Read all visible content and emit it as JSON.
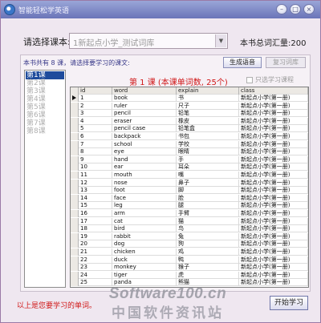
{
  "window": {
    "title": "智能轻松学英语",
    "minimize_glyph": "–",
    "maximize_glyph": "□",
    "close_glyph": "×",
    "title_gradient": [
      "#9aa6d8",
      "#6a74b8"
    ]
  },
  "course": {
    "label": "请选择课本:",
    "selected": "1新起点小学_测试词库",
    "arrow": "▼",
    "vocab_total": "本书总词汇量:200"
  },
  "toolbar": {
    "lesson_count_text": "本书共有 8 课，请选择要学习的课文:",
    "generate_audio_label": "生成语音",
    "review_label": "复习词库"
  },
  "lessons": [
    "第1课",
    "第2课",
    "第3课",
    "第4课",
    "第5课",
    "第6课",
    "第7课",
    "第8课"
  ],
  "selected_lesson_index": 0,
  "lesson_header": {
    "title": "第 1 课 (本课单词数, 25个)",
    "checkbox_label": "只选学习课程"
  },
  "table": {
    "columns": [
      "id",
      "word",
      "explain",
      "class"
    ],
    "rows": [
      [
        "1",
        "book",
        "书",
        "新起点小学(第一册)"
      ],
      [
        "2",
        "ruler",
        "尺子",
        "新起点小学(第一册)"
      ],
      [
        "3",
        "pencil",
        "铅笔",
        "新起点小学(第一册)"
      ],
      [
        "4",
        "eraser",
        "橡皮",
        "新起点小学(第一册)"
      ],
      [
        "5",
        "pencil case",
        "铅笔盒",
        "新起点小学(第一册)"
      ],
      [
        "6",
        "backpack",
        "书包",
        "新起点小学(第一册)"
      ],
      [
        "7",
        "school",
        "学校",
        "新起点小学(第一册)"
      ],
      [
        "8",
        "eye",
        "眼睛",
        "新起点小学(第一册)"
      ],
      [
        "9",
        "hand",
        "手",
        "新起点小学(第一册)"
      ],
      [
        "10",
        "ear",
        "耳朵",
        "新起点小学(第一册)"
      ],
      [
        "11",
        "mouth",
        "嘴",
        "新起点小学(第一册)"
      ],
      [
        "12",
        "nose",
        "鼻子",
        "新起点小学(第一册)"
      ],
      [
        "13",
        "foot",
        "脚",
        "新起点小学(第一册)"
      ],
      [
        "14",
        "face",
        "脸",
        "新起点小学(第一册)"
      ],
      [
        "15",
        "leg",
        "腿",
        "新起点小学(第一册)"
      ],
      [
        "16",
        "arm",
        "手臂",
        "新起点小学(第一册)"
      ],
      [
        "17",
        "cat",
        "猫",
        "新起点小学(第一册)"
      ],
      [
        "18",
        "bird",
        "鸟",
        "新起点小学(第一册)"
      ],
      [
        "19",
        "rabbit",
        "兔",
        "新起点小学(第一册)"
      ],
      [
        "20",
        "dog",
        "狗",
        "新起点小学(第一册)"
      ],
      [
        "21",
        "chicken",
        "鸡",
        "新起点小学(第一册)"
      ],
      [
        "22",
        "duck",
        "鸭",
        "新起点小学(第一册)"
      ],
      [
        "23",
        "monkey",
        "猴子",
        "新起点小学(第一册)"
      ],
      [
        "24",
        "tiger",
        "虎",
        "新起点小学(第一册)"
      ],
      [
        "25",
        "panda",
        "熊猫",
        "新起点小学(第一册)"
      ]
    ]
  },
  "footer": {
    "note": "以上是您要学习的单词。",
    "start_label": "开始学习"
  },
  "watermark": {
    "line1": "Software100.cn",
    "line2": "中国软件资讯站"
  },
  "colors": {
    "accent_red": "#d01818",
    "selection_blue": "#1e4b9c",
    "window_bg": "#efe7f0"
  }
}
